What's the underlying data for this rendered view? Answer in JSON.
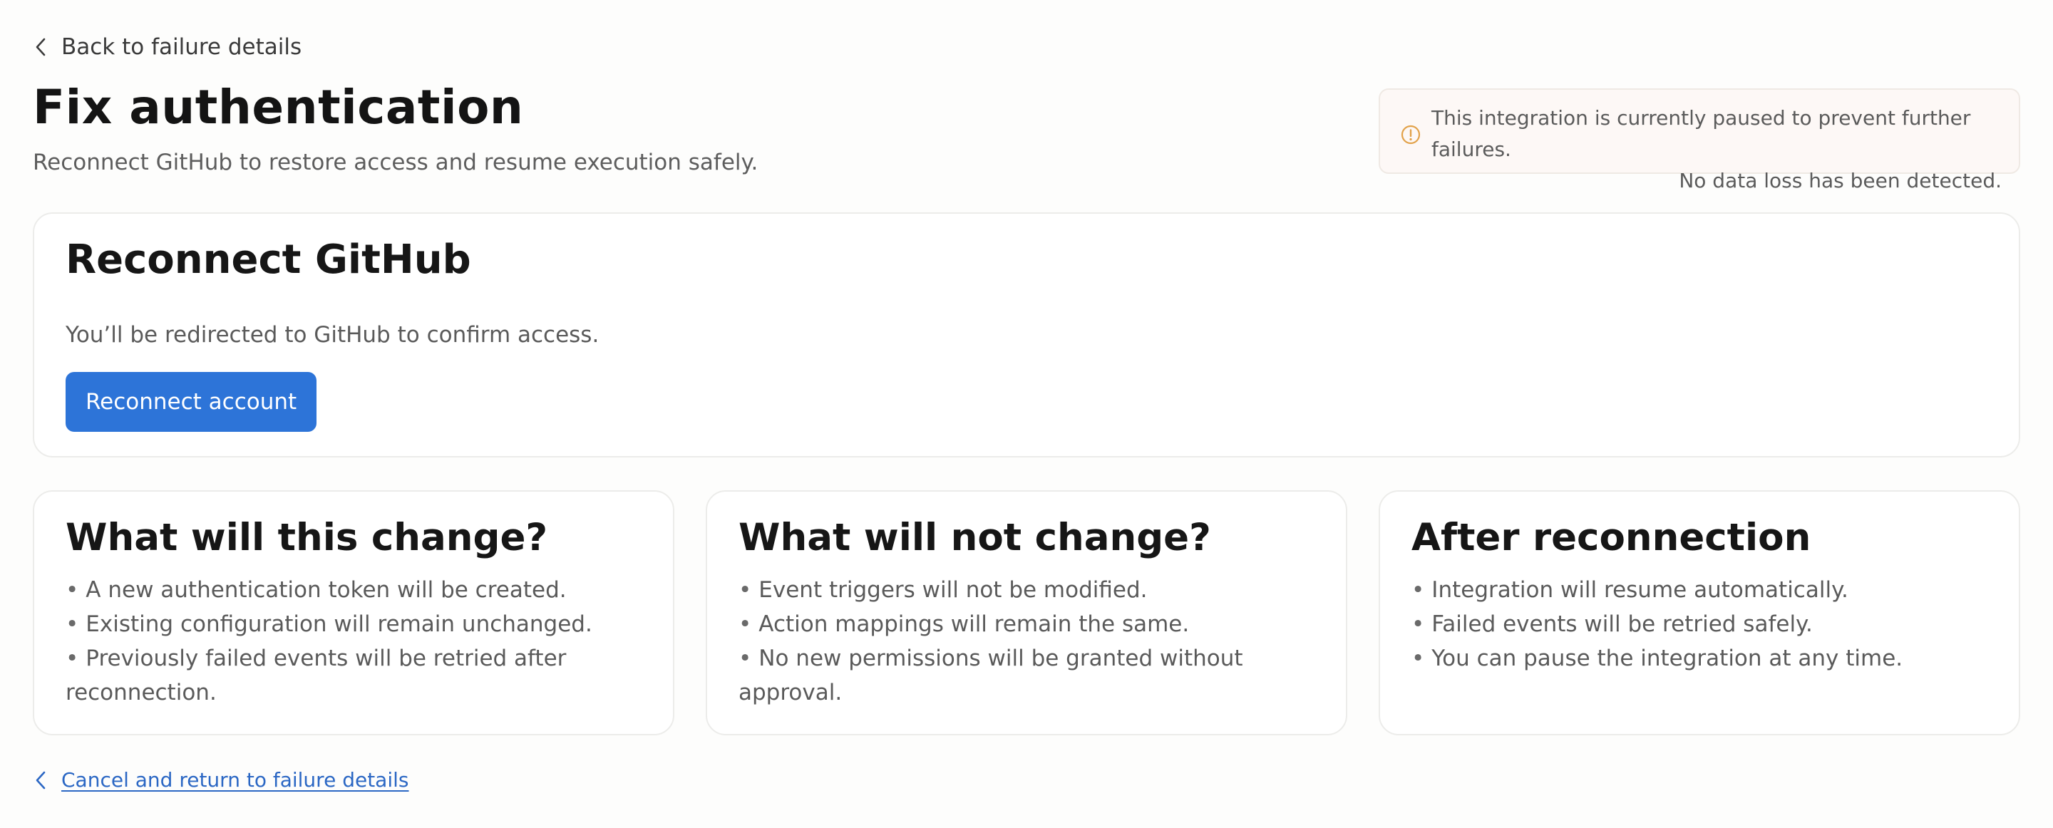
{
  "nav": {
    "back_label": "Back to failure details"
  },
  "header": {
    "title": "Fix authentication",
    "subtitle": "Reconnect GitHub to restore access and resume execution safely."
  },
  "notice": {
    "line1": "This integration is currently paused to prevent further failures.",
    "line2": "No data loss has been detected.",
    "icon": "warning-circle-icon",
    "color": "#e2a24a"
  },
  "reconnect": {
    "title": "Reconnect GitHub",
    "description": "You’ll be redirected to GitHub to confirm access.",
    "button_label": "Reconnect account",
    "button_color": "#2d74d8"
  },
  "cards": [
    {
      "title": "What will this change?",
      "items": [
        "A new authentication token will be created.",
        "Existing configuration will remain unchanged.",
        "Previously failed events will be retried after reconnection."
      ]
    },
    {
      "title": "What will not change?",
      "items": [
        "Event triggers will not be modified.",
        "Action mappings will remain the same.",
        "No new permissions will be granted without approval."
      ]
    },
    {
      "title": "After reconnection",
      "items": [
        "Integration will resume automatically.",
        "Failed events will be retried safely.",
        "You can pause the integration at any time."
      ]
    }
  ],
  "footer": {
    "cancel_label": "Cancel and return to failure details",
    "link_color": "#2b67c4"
  }
}
